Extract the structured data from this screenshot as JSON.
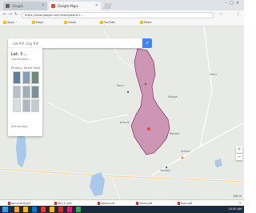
{
  "browser": {
    "tabs": [
      {
        "title": "Google"
      },
      {
        "title": "Google Maps",
        "active": true
      }
    ],
    "address": "https://www.google.com/maps/search/ ...",
    "bookmarks": [
      {
        "label": "Apps"
      },
      {
        "label": "Maps"
      },
      {
        "label": "Gmail"
      },
      {
        "label": "YouTube"
      },
      {
        "label": "News"
      }
    ]
  },
  "map": {
    "search_text": "Lat ##, Lng ##",
    "side_panel": {
      "title": "Lat: 3 ...",
      "subtitle": "coordinates ...",
      "tabs_label": "Photos  |  Street View",
      "footer": "See photos",
      "photos": [
        "#5f7f9a",
        "#84a0b3",
        "#6e8a7a",
        "#b6c2c8",
        "#9fb0bb",
        "#7c8f9b",
        "#d8dde0",
        "#aab9c2",
        "#c3cad0"
      ]
    },
    "labels": [
      {
        "text": "Pond"
      },
      {
        "text": "Village"
      },
      {
        "text": "Area B"
      },
      {
        "text": "Market"
      },
      {
        "text": "School"
      },
      {
        "text": "Temple"
      },
      {
        "text": "Farm"
      }
    ],
    "scale": "200 m"
  },
  "downloads": [
    {
      "label": "document.pdf"
    },
    {
      "label": "file (1).pdf"
    },
    {
      "label": "report.pdf"
    },
    {
      "label": "notes.pdf"
    },
    {
      "label": "map.pdf"
    }
  ],
  "taskbar": {
    "icons": [
      "#e8a33d",
      "#ffb900",
      "#0078d7",
      "#e53935",
      "#ffb900",
      "#d93025",
      "#e91e63",
      "#34a853"
    ],
    "clock": "10:30 AM"
  },
  "colors": {
    "polygon_fill": "#c987ab",
    "polygon_stroke": "#8e3f6a",
    "water": "#a9c9ea",
    "accent_blue": "#4285f4"
  }
}
